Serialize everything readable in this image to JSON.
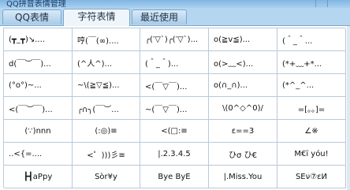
{
  "window": {
    "title": "QQ拼音表情管理"
  },
  "tabs": [
    {
      "label": "QQ表情"
    },
    {
      "label": "字符表情"
    },
    {
      "label": "最近使用"
    }
  ],
  "active_tab": "字符表情",
  "emoticons": [
    [
      "(┳_┳)↘....",
      "哼(￣(∞)....",
      "╭(′▽`)╭(′▽`)...",
      "o(≧v≦)...",
      "(＾_＾..."
    ],
    [
      "d(￣︶￣)...",
      "(^人^)...",
      "(＾_＾)...",
      "o(>﹏<)...",
      "(*+﹏+*..."
    ],
    [
      "(°o°)~...",
      "~\\(≧▽≦)...",
      "<(￣▽￣)...",
      "o(∩_∩)...",
      "(*^_^..."
    ],
    [
      "<(￣︶￣)...",
      "╭∩╮(￣︶...",
      "~(￣▽￣)...",
      "\\(0^◇^0)/",
      "=[。。]="
    ],
    [
      "(∵)nnn",
      "(:◎)≡",
      "<(□:≡",
      "ε==3",
      "∠※"
    ],
    [
      "..<{=....",
      "<゜)))彡≡",
      "|.2.3.4.5",
      "ひσ ひ€",
      "M€ï yóu!"
    ],
    [
      "┣┫aPpy",
      "Sòr¥y",
      "Bye ByE",
      "|.Miss.You",
      "SΕν⑦εИ"
    ]
  ]
}
